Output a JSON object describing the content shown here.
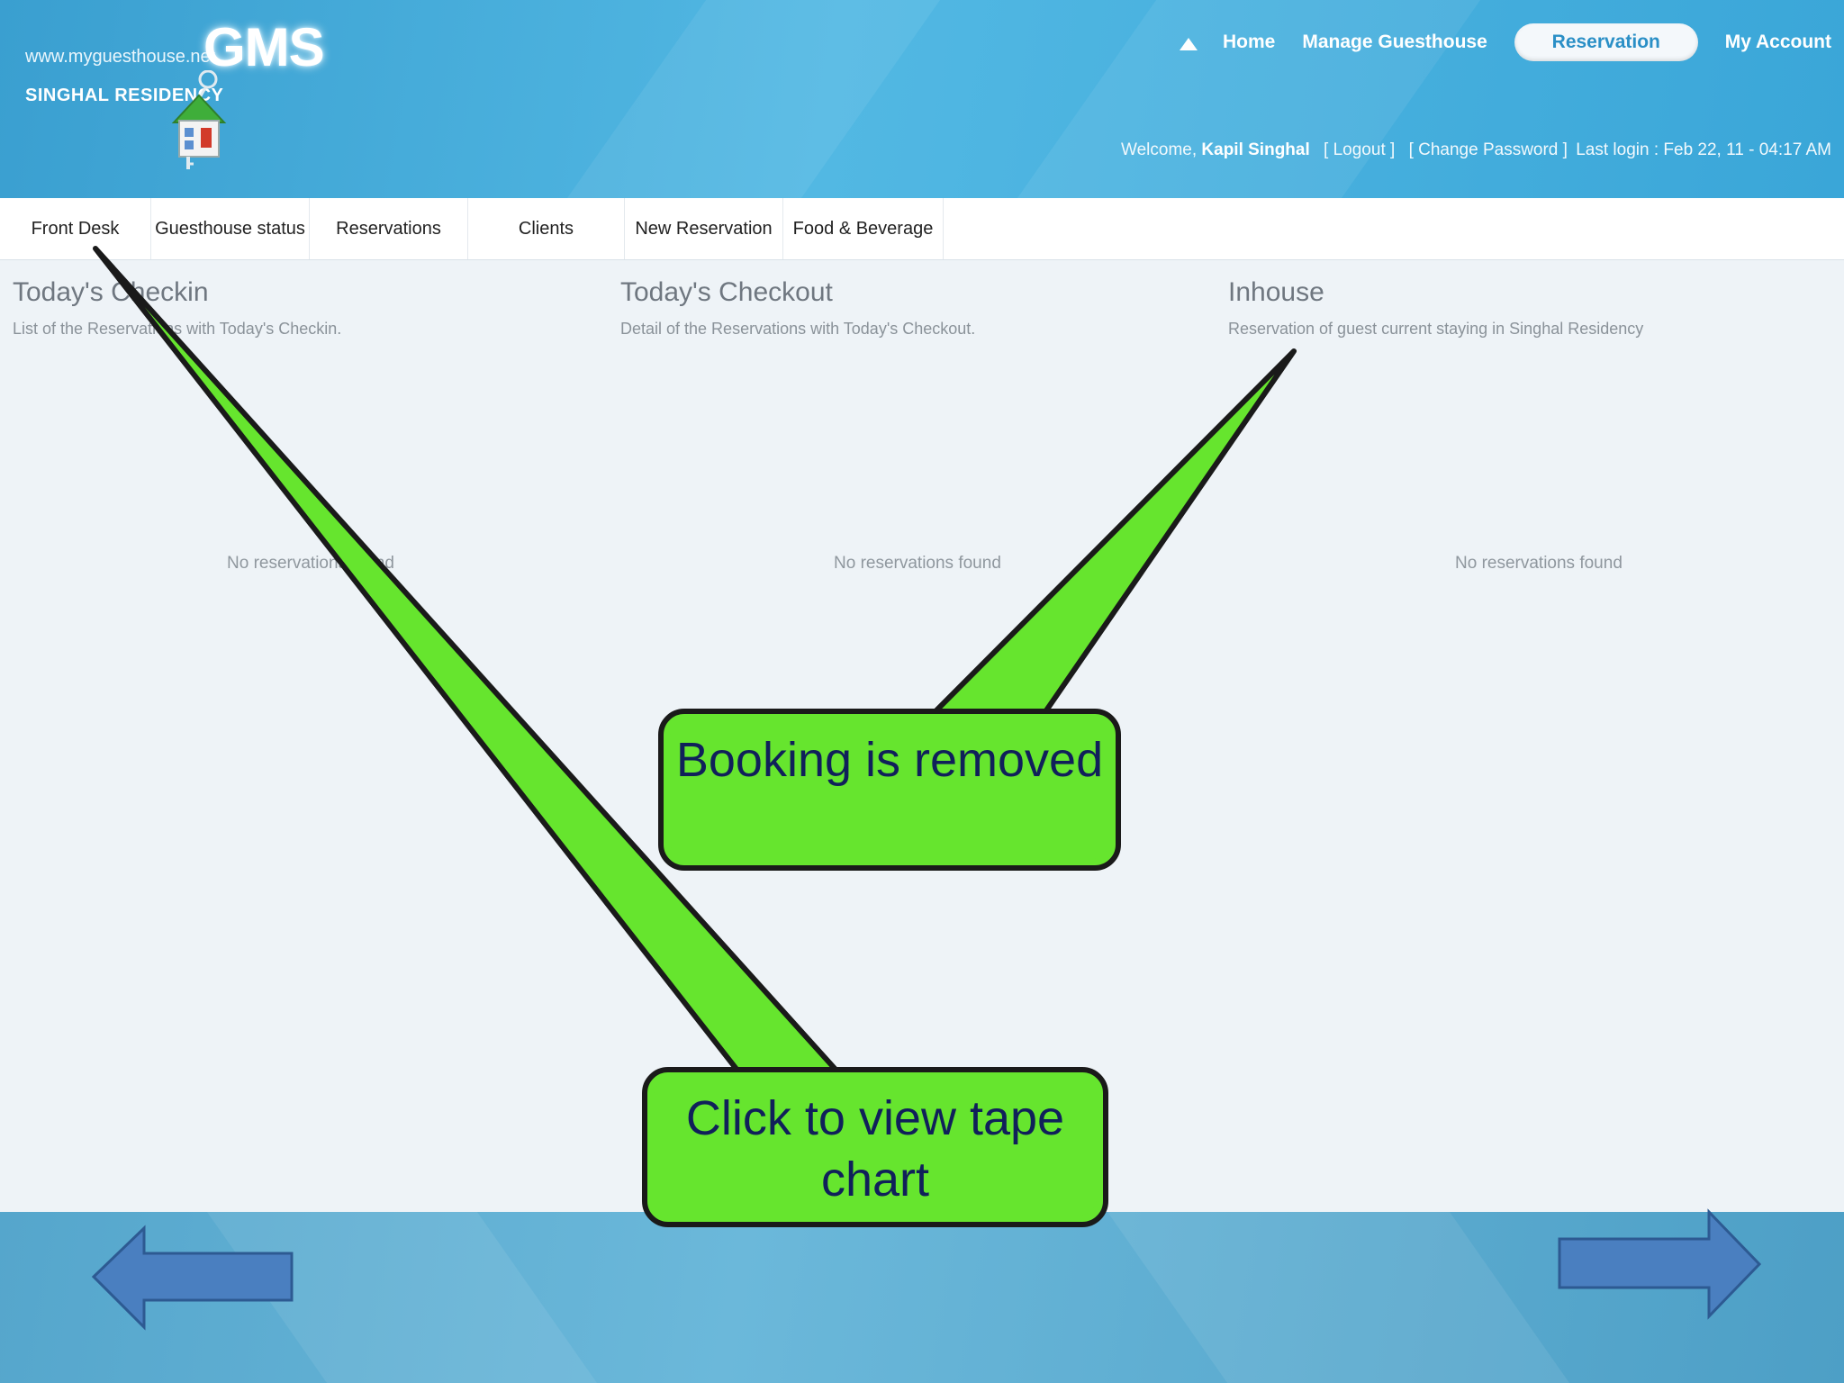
{
  "header": {
    "site_url": "www.myguesthouse.net",
    "brand_name": "SINGHAL RESIDENCY",
    "logo_text": "GMS",
    "nav": {
      "home": "Home",
      "manage": "Manage Guesthouse",
      "reservation": "Reservation",
      "account": "My Account"
    },
    "user_bar": {
      "welcome": "Welcome,",
      "user_name": "Kapil Singhal",
      "logout": "[ Logout ]",
      "change_password": "[ Change Password ]",
      "last_login": "Last login : Feb 22, 11 - 04:17 AM"
    }
  },
  "tabs": [
    {
      "label": "Front Desk"
    },
    {
      "label": "Guesthouse status"
    },
    {
      "label": "Reservations"
    },
    {
      "label": "Clients"
    },
    {
      "label": "New Reservation"
    },
    {
      "label": "Food & Beverage"
    }
  ],
  "panels": {
    "checkin": {
      "title": "Today's Checkin",
      "desc": "List of the Reservations with Today's Checkin.",
      "empty": "No reservations found"
    },
    "checkout": {
      "title": "Today's Checkout",
      "desc": "Detail of the Reservations with Today's Checkout.",
      "empty": "No reservations found"
    },
    "inhouse": {
      "title": "Inhouse",
      "desc": "Reservation of guest current staying in Singhal Residency",
      "empty": "No reservations found"
    }
  },
  "callouts": {
    "booking": "Booking is removed",
    "tape": "Click to view tape chart"
  },
  "colors": {
    "callout_fill": "#66e52e",
    "arrow_fill": "#4a7fc0",
    "header_blue": "#45aede"
  },
  "icons": {
    "logo": "house-key-icon",
    "prev": "arrow-left-icon",
    "next": "arrow-right-icon",
    "scroll": "arrow-up-icon"
  }
}
